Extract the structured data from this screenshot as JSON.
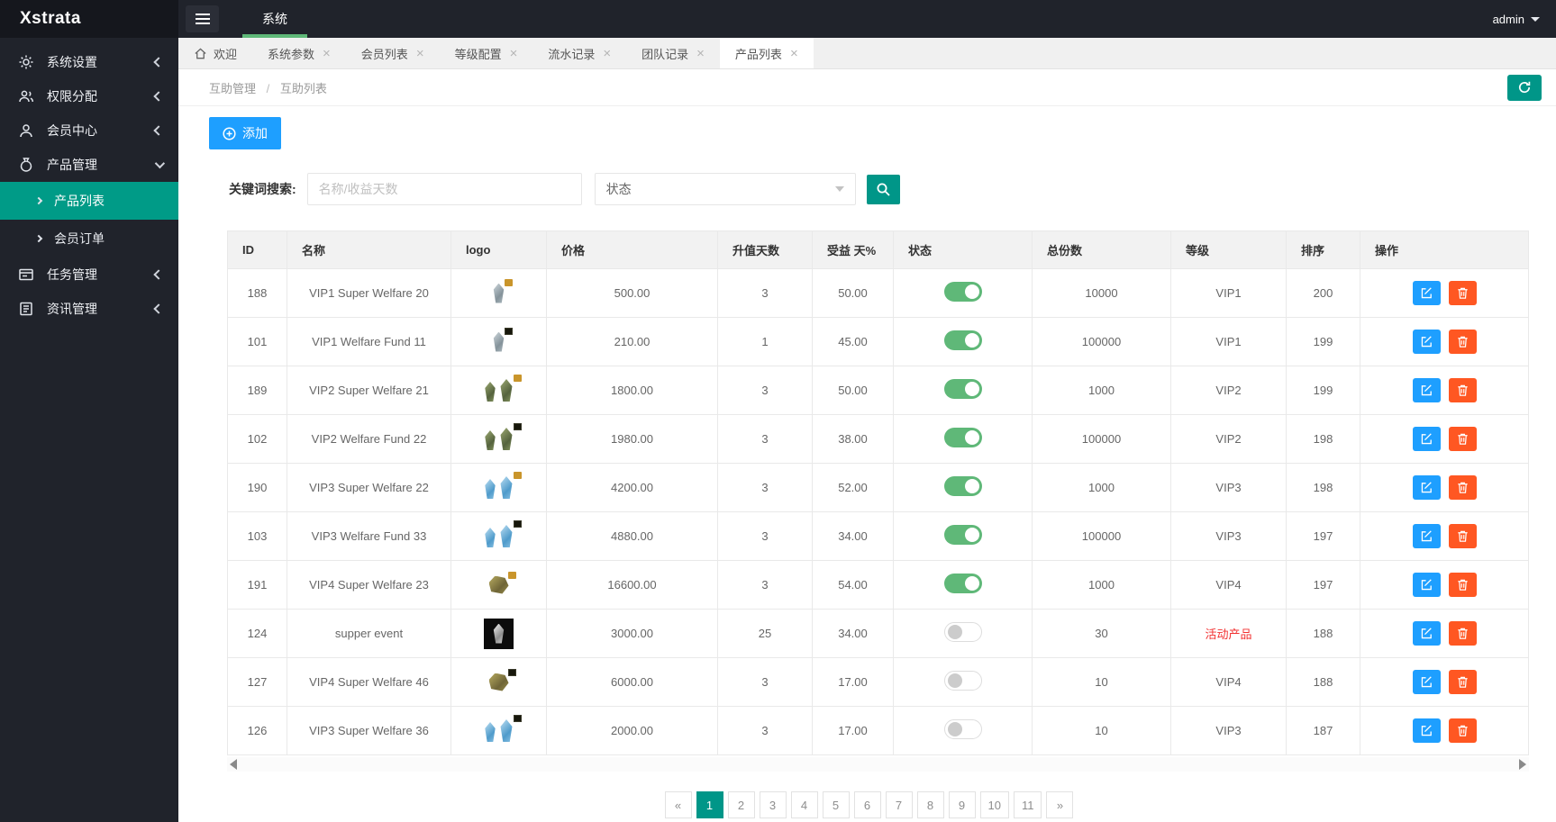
{
  "app": {
    "logo": "Xstrata",
    "admin_user": "admin"
  },
  "topbar": {
    "module_tab": "系统"
  },
  "sidebar": {
    "items": [
      {
        "label": "系统设置",
        "icon": "gear-icon"
      },
      {
        "label": "权限分配",
        "icon": "users-icon"
      },
      {
        "label": "会员中心",
        "icon": "user-icon"
      },
      {
        "label": "产品管理",
        "icon": "bag-icon",
        "open": true,
        "children": [
          {
            "label": "产品列表",
            "active": true
          },
          {
            "label": "会员订单",
            "active": false
          }
        ]
      },
      {
        "label": "任务管理",
        "icon": "task-icon"
      },
      {
        "label": "资讯管理",
        "icon": "news-icon"
      }
    ]
  },
  "tabs": [
    {
      "label": "欢迎",
      "home": true
    },
    {
      "label": "系统参数"
    },
    {
      "label": "会员列表"
    },
    {
      "label": "等级配置"
    },
    {
      "label": "流水记录"
    },
    {
      "label": "团队记录"
    },
    {
      "label": "产品列表",
      "active": true
    }
  ],
  "breadcrumb": {
    "parent": "互助管理",
    "separator": "/",
    "current": "互助列表"
  },
  "toolbar": {
    "add_label": "添加"
  },
  "search": {
    "label": "关键词搜索:",
    "keyword_placeholder": "名称/收益天数",
    "status_value": "状态"
  },
  "table": {
    "headers": [
      "ID",
      "名称",
      "logo",
      "价格",
      "升值天数",
      "受益 天%",
      "状态",
      "总份数",
      "等级",
      "排序",
      "操作"
    ],
    "rows": [
      {
        "id": "188",
        "name": "VIP1 Super Welfare 20",
        "logo": {
          "shape": "gem-silver",
          "pair": false,
          "tag": "gold",
          "dark_bg": false
        },
        "price": "500.00",
        "days": "3",
        "profit": "50.00",
        "status": "on",
        "total": "10000",
        "level": "VIP1",
        "level_red": false,
        "sort": "200"
      },
      {
        "id": "101",
        "name": "VIP1 Welfare Fund 11",
        "logo": {
          "shape": "gem-silver",
          "pair": false,
          "tag": "dark",
          "dark_bg": false
        },
        "price": "210.00",
        "days": "1",
        "profit": "45.00",
        "status": "on",
        "total": "100000",
        "level": "VIP1",
        "level_red": false,
        "sort": "199"
      },
      {
        "id": "189",
        "name": "VIP2 Super Welfare 21",
        "logo": {
          "shape": "gem-green",
          "pair": true,
          "tag": "gold",
          "dark_bg": false
        },
        "price": "1800.00",
        "days": "3",
        "profit": "50.00",
        "status": "on",
        "total": "1000",
        "level": "VIP2",
        "level_red": false,
        "sort": "199"
      },
      {
        "id": "102",
        "name": "VIP2 Welfare Fund 22",
        "logo": {
          "shape": "gem-green",
          "pair": true,
          "tag": "dark",
          "dark_bg": false
        },
        "price": "1980.00",
        "days": "3",
        "profit": "38.00",
        "status": "on",
        "total": "100000",
        "level": "VIP2",
        "level_red": false,
        "sort": "198"
      },
      {
        "id": "190",
        "name": "VIP3 Super Welfare 22",
        "logo": {
          "shape": "gem-blue",
          "pair": true,
          "tag": "gold",
          "dark_bg": false
        },
        "price": "4200.00",
        "days": "3",
        "profit": "52.00",
        "status": "on",
        "total": "1000",
        "level": "VIP3",
        "level_red": false,
        "sort": "198"
      },
      {
        "id": "103",
        "name": "VIP3 Welfare Fund 33",
        "logo": {
          "shape": "gem-blue",
          "pair": true,
          "tag": "dark",
          "dark_bg": false
        },
        "price": "4880.00",
        "days": "3",
        "profit": "34.00",
        "status": "on",
        "total": "100000",
        "level": "VIP3",
        "level_red": false,
        "sort": "197"
      },
      {
        "id": "191",
        "name": "VIP4 Super Welfare 23",
        "logo": {
          "shape": "gem-gold",
          "pair": false,
          "tag": "gold",
          "dark_bg": false,
          "nugget": true
        },
        "price": "16600.00",
        "days": "3",
        "profit": "54.00",
        "status": "on",
        "total": "1000",
        "level": "VIP4",
        "level_red": false,
        "sort": "197"
      },
      {
        "id": "124",
        "name": "supper event",
        "logo": {
          "shape": "gem-white",
          "pair": false,
          "tag": "",
          "dark_bg": true
        },
        "price": "3000.00",
        "days": "25",
        "profit": "34.00",
        "status": "off",
        "total": "30",
        "level": "活动产品",
        "level_red": true,
        "sort": "188"
      },
      {
        "id": "127",
        "name": "VIP4 Super Welfare 46",
        "logo": {
          "shape": "gem-gold",
          "pair": false,
          "tag": "dark",
          "dark_bg": false,
          "nugget": true
        },
        "price": "6000.00",
        "days": "3",
        "profit": "17.00",
        "status": "off",
        "total": "10",
        "level": "VIP4",
        "level_red": false,
        "sort": "188"
      },
      {
        "id": "126",
        "name": "VIP3 Super Welfare 36",
        "logo": {
          "shape": "gem-blue",
          "pair": true,
          "tag": "dark",
          "dark_bg": false
        },
        "price": "2000.00",
        "days": "3",
        "profit": "17.00",
        "status": "off",
        "total": "10",
        "level": "VIP3",
        "level_red": false,
        "sort": "187"
      }
    ]
  },
  "pagination": {
    "items": [
      "«",
      "1",
      "2",
      "3",
      "4",
      "5",
      "6",
      "7",
      "8",
      "9",
      "10",
      "11",
      "»"
    ],
    "active": "1"
  },
  "colors": {
    "accent_teal": "#009688",
    "add_blue": "#1E9FFF",
    "delete_orange": "#FF5722",
    "toggle_green": "#5FB878",
    "module_underline_green": "#5FB878",
    "level_red": "#f23030",
    "sidebar_dark": "#20232b"
  }
}
